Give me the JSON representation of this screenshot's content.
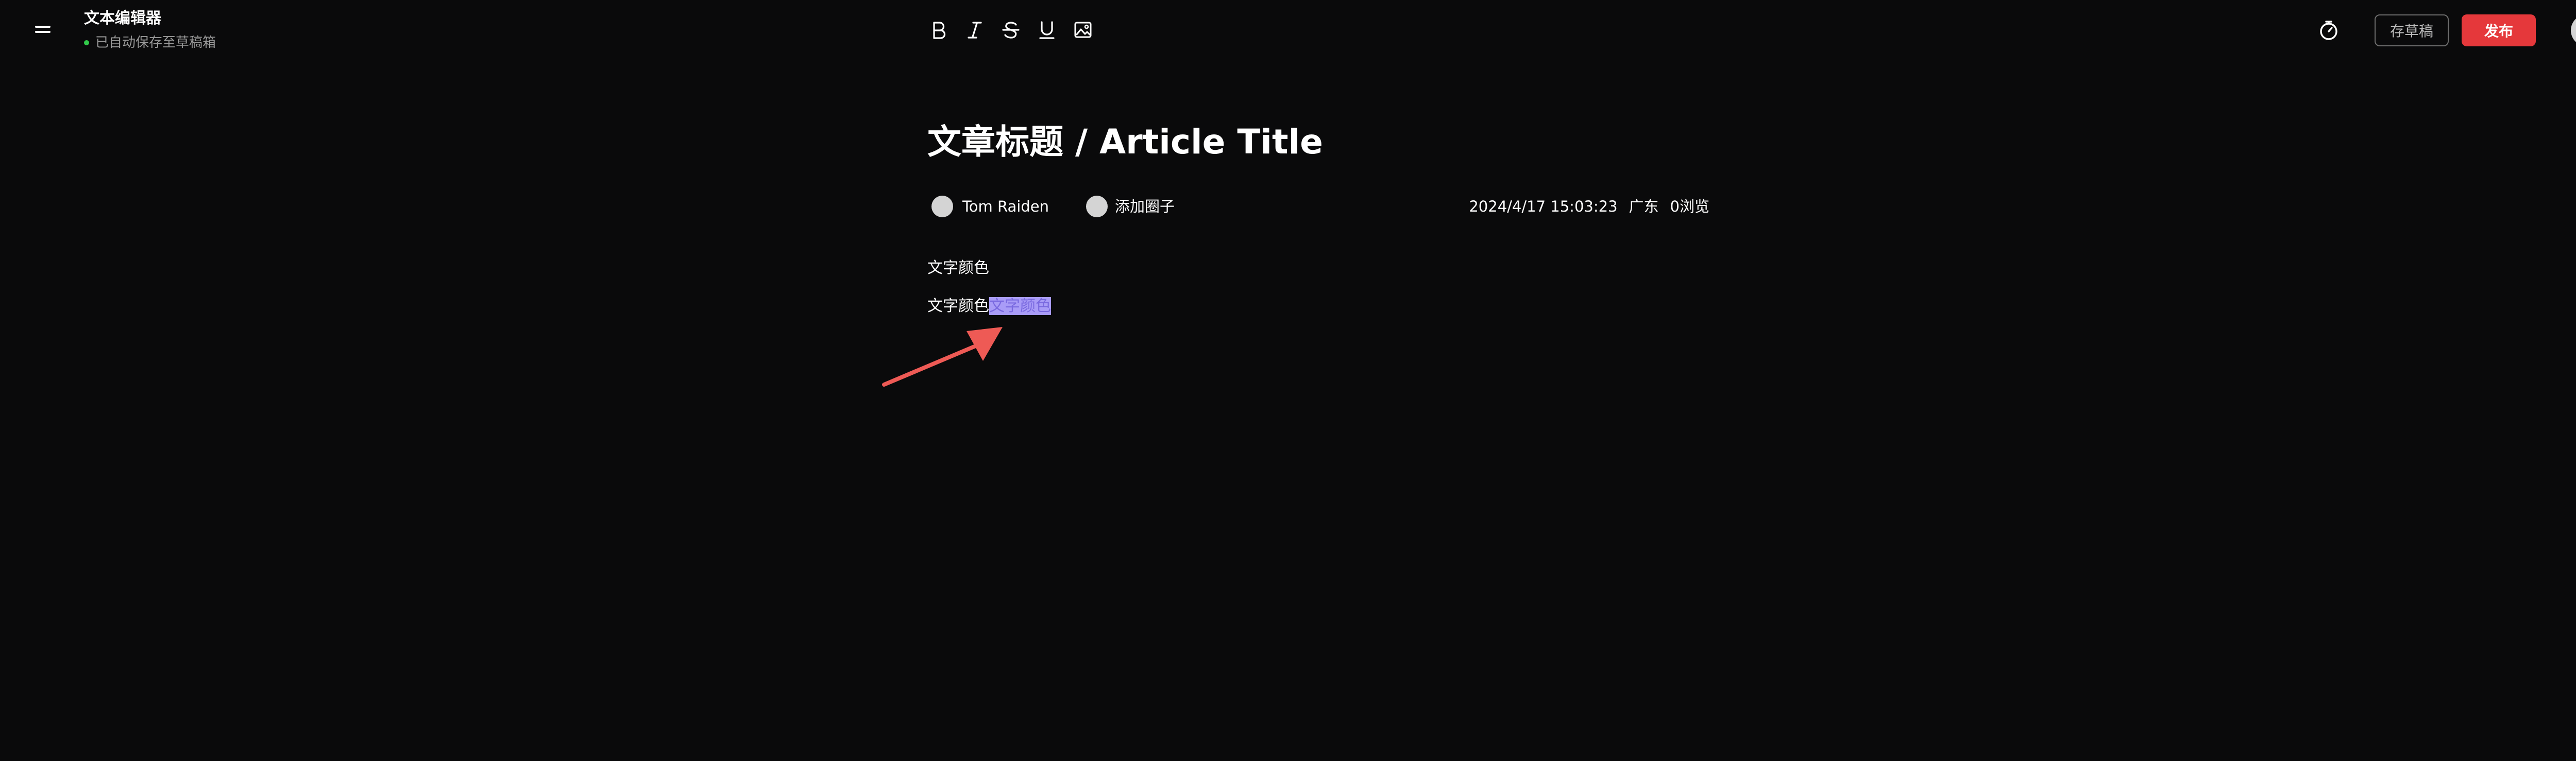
{
  "header": {
    "app_title": "文本编辑器",
    "save_status": "已自动保存至草稿箱",
    "status_color": "#31c94a",
    "menu_icon": "hamburger-menu-icon"
  },
  "toolbar": {
    "items": [
      {
        "name": "bold",
        "icon": "bold-icon"
      },
      {
        "name": "italic",
        "icon": "italic-icon"
      },
      {
        "name": "strikethrough",
        "icon": "strikethrough-icon"
      },
      {
        "name": "underline",
        "icon": "underline-icon"
      },
      {
        "name": "image",
        "icon": "image-icon"
      }
    ]
  },
  "actions": {
    "timer_icon": "timer-icon",
    "draft_label": "存草稿",
    "publish_label": "发布",
    "publish_color": "#e5383b"
  },
  "article": {
    "title": "文章标题 / Article Title",
    "author": "Tom Raiden",
    "add_circle": "添加圈子",
    "datetime": "2024/4/17 15:03:23",
    "location": "广东",
    "views": "0浏览",
    "paragraphs": [
      {
        "text": "文字颜色"
      },
      {
        "text": "文字颜色",
        "highlighted": "文字颜色"
      }
    ],
    "highlight_color": "#a99cf7",
    "annotation_color": "#ee5a55"
  }
}
